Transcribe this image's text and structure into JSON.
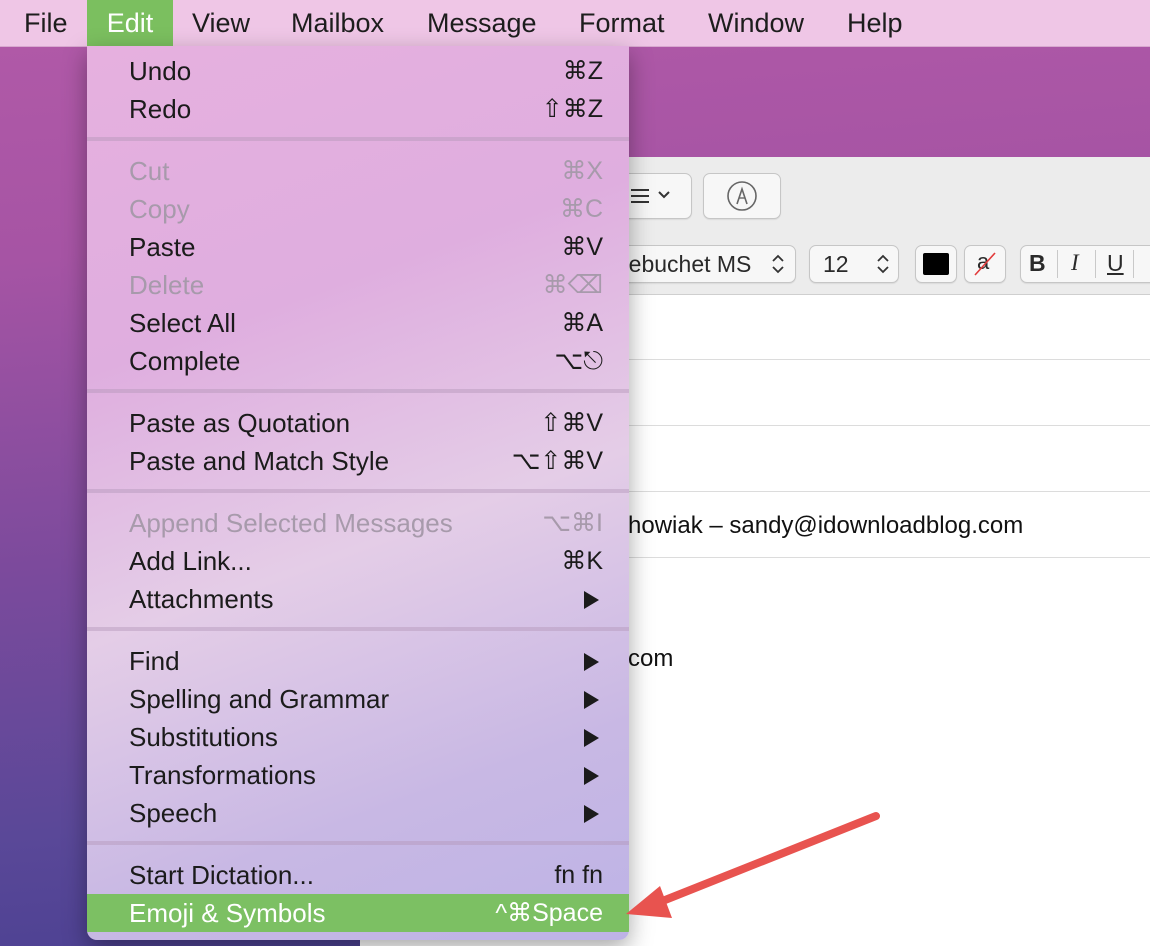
{
  "menubar": {
    "items": [
      "File",
      "Edit",
      "View",
      "Mailbox",
      "Message",
      "Format",
      "Window",
      "Help"
    ],
    "active": "Edit"
  },
  "toolbar": {
    "list_icon": "list-bullets-icon",
    "markup_icon": "markup-pen-icon",
    "font_name": "rebuchet MS",
    "font_size": "12",
    "text_color": "#000000",
    "bold": "B",
    "italic": "I",
    "underline": "U",
    "strike_glyph": "a"
  },
  "compose": {
    "from_line": "howiak – sandy@idownloadblog.com",
    "body_fragment": "com"
  },
  "edit_menu": {
    "groups": [
      [
        {
          "label": "Undo",
          "shortcut": "⌘Z",
          "enabled": true
        },
        {
          "label": "Redo",
          "shortcut": "⇧⌘Z",
          "enabled": true
        }
      ],
      [
        {
          "label": "Cut",
          "shortcut": "⌘X",
          "enabled": false
        },
        {
          "label": "Copy",
          "shortcut": "⌘C",
          "enabled": false
        },
        {
          "label": "Paste",
          "shortcut": "⌘V",
          "enabled": true
        },
        {
          "label": "Delete",
          "shortcut": "⌘⌫",
          "enabled": false
        },
        {
          "label": "Select All",
          "shortcut": "⌘A",
          "enabled": true
        },
        {
          "label": "Complete",
          "shortcut": "⌥⎋",
          "enabled": true
        }
      ],
      [
        {
          "label": "Paste as Quotation",
          "shortcut": "⇧⌘V",
          "enabled": true
        },
        {
          "label": "Paste and Match Style",
          "shortcut": "⌥⇧⌘V",
          "enabled": true
        }
      ],
      [
        {
          "label": "Append Selected Messages",
          "shortcut": "⌥⌘I",
          "enabled": false
        },
        {
          "label": "Add Link...",
          "shortcut": "⌘K",
          "enabled": true
        },
        {
          "label": "Attachments",
          "submenu": true,
          "enabled": true
        }
      ],
      [
        {
          "label": "Find",
          "submenu": true,
          "enabled": true
        },
        {
          "label": "Spelling and Grammar",
          "submenu": true,
          "enabled": true
        },
        {
          "label": "Substitutions",
          "submenu": true,
          "enabled": true
        },
        {
          "label": "Transformations",
          "submenu": true,
          "enabled": true
        },
        {
          "label": "Speech",
          "submenu": true,
          "enabled": true
        }
      ],
      [
        {
          "label": "Start Dictation...",
          "shortcut": "fn fn",
          "enabled": true
        },
        {
          "label": "Emoji & Symbols",
          "shortcut": "^⌘Space",
          "enabled": true,
          "highlighted": true
        }
      ]
    ]
  },
  "colors": {
    "menubar_bg": "#efc6e6",
    "highlight": "#7cc063",
    "annotation_arrow": "#e8534f"
  }
}
